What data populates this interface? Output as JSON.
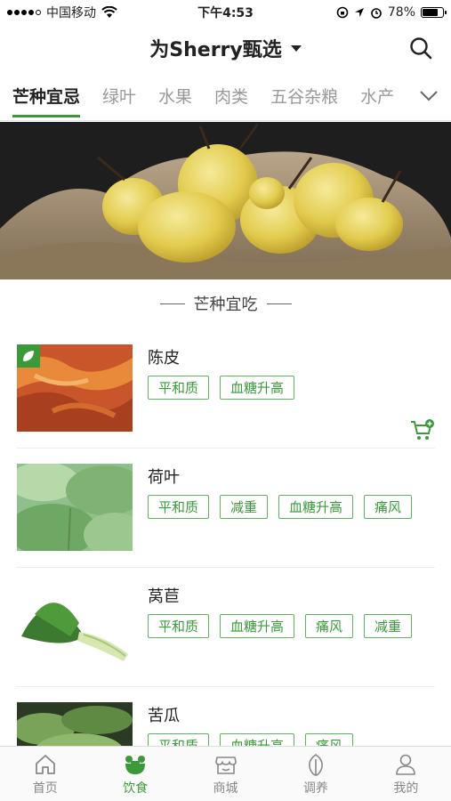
{
  "status_bar": {
    "carrier": "中国移动",
    "time": "下午4:53",
    "battery_percent": "78%",
    "battery_level": 0.78
  },
  "nav": {
    "title": "为Sherry甄选"
  },
  "tabs": [
    {
      "label": "芒种宜忌",
      "active": true
    },
    {
      "label": "绿叶",
      "active": false
    },
    {
      "label": "水果",
      "active": false
    },
    {
      "label": "肉类",
      "active": false
    },
    {
      "label": "五谷杂粮",
      "active": false
    },
    {
      "label": "水产",
      "active": false
    }
  ],
  "section": {
    "title": "芒种宜吃"
  },
  "foods": [
    {
      "name": "陈皮",
      "tags": [
        "平和质",
        "血糖升高"
      ],
      "image": "dried-tangerine-peel",
      "has_badge": true,
      "has_cart": true
    },
    {
      "name": "荷叶",
      "tags": [
        "平和质",
        "减重",
        "血糖升高",
        "痛风"
      ],
      "image": "lotus-leaf",
      "has_badge": false,
      "has_cart": false
    },
    {
      "name": "莴苣",
      "tags": [
        "平和质",
        "血糖升高",
        "痛风",
        "减重"
      ],
      "image": "lettuce",
      "has_badge": false,
      "has_cart": false
    },
    {
      "name": "苦瓜",
      "tags": [
        "平和质",
        "血糖升高",
        "痛风"
      ],
      "image": "bitter-melon",
      "has_badge": false,
      "has_cart": false
    }
  ],
  "tabbar": [
    {
      "label": "首页",
      "icon": "home-icon",
      "active": false
    },
    {
      "label": "饮食",
      "icon": "food-icon",
      "active": true
    },
    {
      "label": "商城",
      "icon": "store-icon",
      "active": false
    },
    {
      "label": "调养",
      "icon": "leaf-icon",
      "active": false
    },
    {
      "label": "我的",
      "icon": "profile-icon",
      "active": false
    }
  ],
  "colors": {
    "accent": "#3a9a3a",
    "tag_border": "#5fb35f"
  }
}
